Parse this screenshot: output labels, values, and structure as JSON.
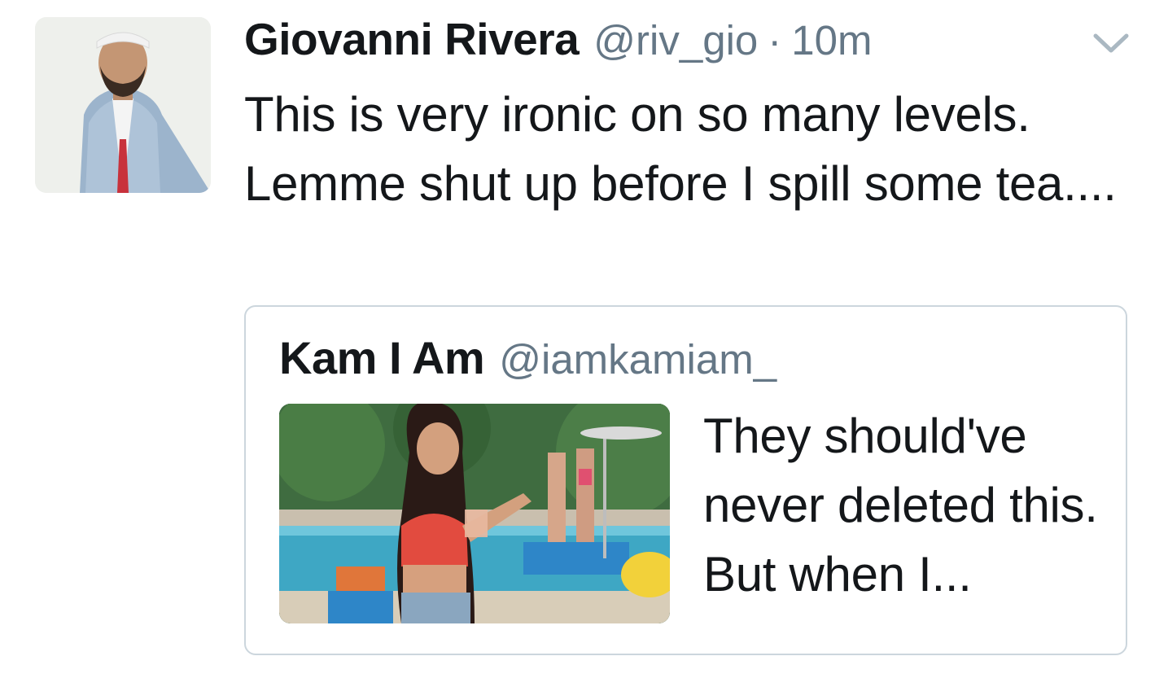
{
  "tweet": {
    "author_name": "Giovanni Rivera",
    "author_handle": "@riv_gio",
    "separator": "·",
    "timestamp": "10m",
    "text": "This is very ironic on so many levels. Lemme shut up before I spill some tea....",
    "menu_icon": "chevron-down-icon"
  },
  "quote": {
    "author_name": "Kam I Am",
    "author_handle": "@iamkamiam_",
    "text": "They should've never deleted this. But when I..."
  },
  "colors": {
    "primary_text": "#14171a",
    "secondary_text": "#657786",
    "card_border": "#ccd6dd",
    "chevron": "#aab8c2"
  }
}
